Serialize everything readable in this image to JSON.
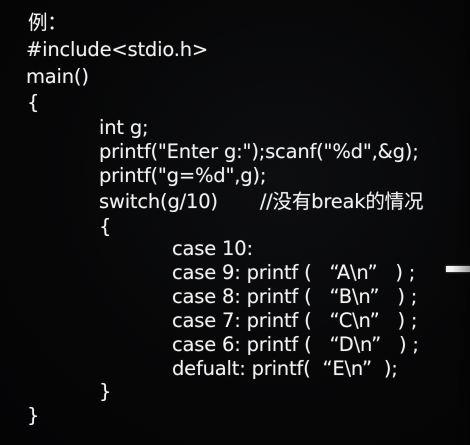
{
  "code": {
    "lines": [
      "例：",
      "#include<stdio.h>",
      "main()",
      "{",
      "int g;",
      "printf(\"Enter g:\");scanf(\"%d\",&g);",
      "printf(\"g=%d\",g);",
      "switch(g/10)       //没有break的情况",
      "{",
      "case 10:",
      "case 9: printf (   “A\\n”   ) ;",
      "case 8: printf (   “B\\n”   ) ;",
      "case 7: printf (   “C\\n”   ) ;",
      "case 6: printf (   “D\\n”   ) ;",
      "defualt: printf(  “E\\n”  );",
      "}",
      "}"
    ]
  }
}
